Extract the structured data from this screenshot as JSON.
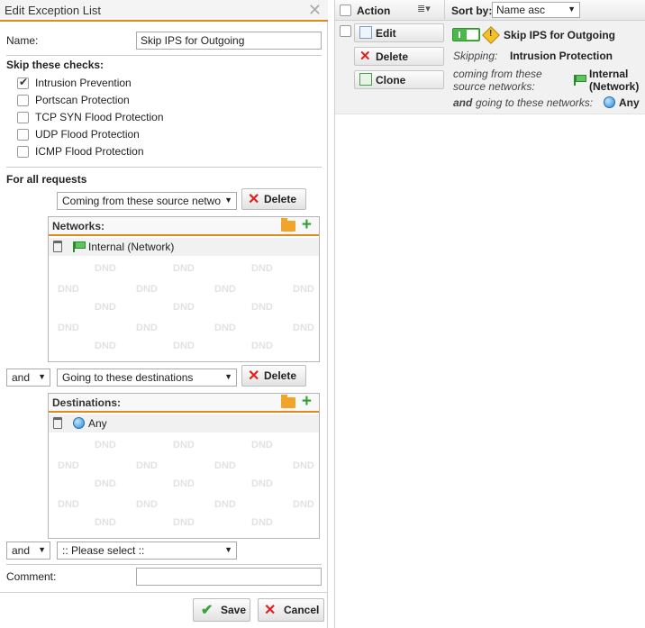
{
  "dialog": {
    "title": "Edit Exception List",
    "name_label": "Name:",
    "name_value": "Skip IPS for Outgoing",
    "skip_heading": "Skip these checks:",
    "checks": [
      {
        "label": "Intrusion Prevention",
        "checked": true
      },
      {
        "label": "Portscan Protection",
        "checked": false
      },
      {
        "label": "TCP SYN Flood Protection",
        "checked": false
      },
      {
        "label": "UDP Flood Protection",
        "checked": false
      },
      {
        "label": "ICMP Flood Protection",
        "checked": false
      }
    ],
    "for_all_requests": "For all requests",
    "condition1": {
      "select": "Coming from these source netwo",
      "delete_label": "Delete"
    },
    "networks_panel": {
      "title": "Networks:",
      "item": "Internal (Network)"
    },
    "condition2": {
      "conj": "and",
      "select": "Going to these destinations",
      "delete_label": "Delete"
    },
    "destinations_panel": {
      "title": "Destinations:",
      "item": "Any"
    },
    "condition3": {
      "conj": "and",
      "select": ":: Please select ::"
    },
    "dnd_text": "DND",
    "comment_label": "Comment:",
    "comment_value": "",
    "save_label": "Save",
    "cancel_label": "Cancel"
  },
  "list": {
    "header": {
      "action": "Action",
      "sort_by_label": "Sort by:",
      "sort_value": "Name asc"
    },
    "row": {
      "edit_label": "Edit",
      "delete_label": "Delete",
      "clone_label": "Clone",
      "name": "Skip IPS for Outgoing",
      "skipping_label": "Skipping:",
      "skipping_value": "Intrusion Protection",
      "coming_from_line1": "coming from these",
      "coming_from_line2": "source networks:",
      "source_line1": "Internal",
      "source_line2": "(Network)",
      "going_and": "and",
      "going_rest": "going to these networks:",
      "destination": "Any"
    }
  },
  "colors": {
    "accent": "#e08a1e",
    "add": "#2ea12e",
    "delete": "#d22222",
    "enabled": "#4cb84c"
  }
}
